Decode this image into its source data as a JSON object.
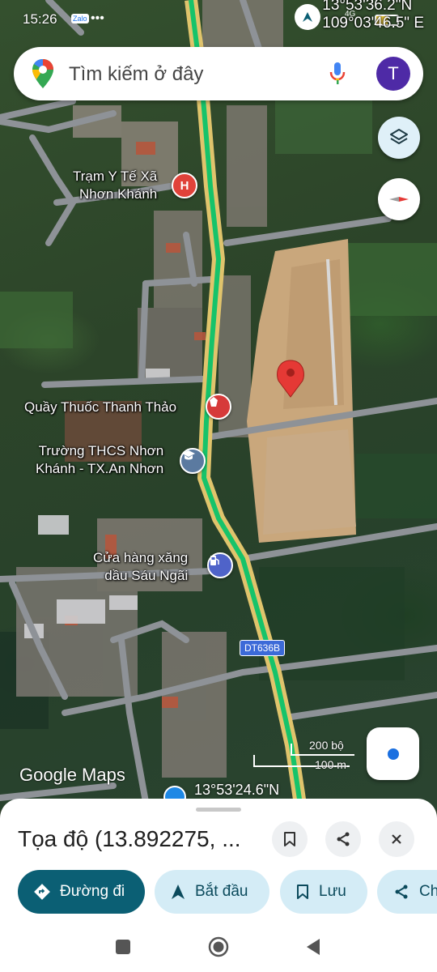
{
  "status_bar": {
    "time": "15:26",
    "zalo_label": "Zalo",
    "more_icon": "more-dots-icon",
    "network": "4G",
    "coordinates_overlay": [
      "13°53'36.2\"N",
      "109°03'46.5\" E"
    ]
  },
  "search": {
    "placeholder": "Tìm kiếm ở đây",
    "avatar_letter": "T",
    "mic_icon": "mic-icon"
  },
  "map": {
    "labels": {
      "health_station": [
        "Trạm Y Tế Xã",
        "Nhơn Khánh"
      ],
      "pharmacy": [
        "Quầy Thuốc Thanh Thảo"
      ],
      "school": [
        "Trường THCS Nhơn",
        "Khánh - TX.An Nhơn"
      ],
      "gas_station": [
        "Cửa hàng xăng",
        "dầu Sáu Ngãi"
      ]
    },
    "road_badge": "DT636B",
    "pin_coordinate": "13°53'24.6\"N",
    "logo": "Google Maps",
    "scale": {
      "top": "200 bộ",
      "bottom": "100 m"
    }
  },
  "bottom_sheet": {
    "title": "Tọa độ (13.892275, ...",
    "actions": [
      {
        "label": "Đường đi",
        "icon": "directions-icon"
      },
      {
        "label": "Bắt đầu",
        "icon": "navigation-arrow-icon"
      },
      {
        "label": "Lưu",
        "icon": "bookmark-icon"
      },
      {
        "label": "Ch",
        "icon": "share-icon"
      }
    ]
  },
  "colors": {
    "accent": "#0b5f74",
    "chip_bg": "#d4ecf6",
    "pin_red": "#e53935",
    "avatar": "#4e2aa6"
  }
}
